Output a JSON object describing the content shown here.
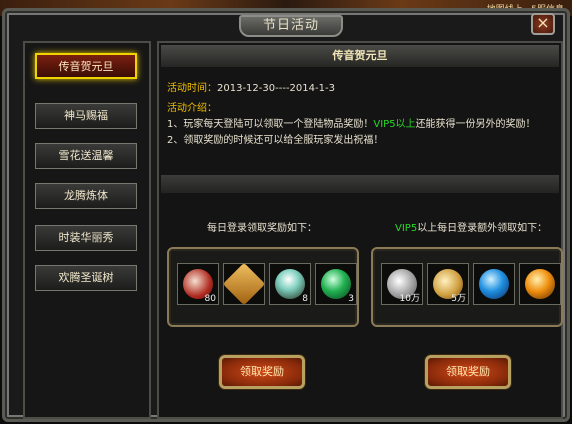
{
  "scene": {
    "top_sliver_text": "地图线上  ·  5服信息"
  },
  "window": {
    "title": "节日活动",
    "close_glyph": "×"
  },
  "sidebar": {
    "items": [
      {
        "label": "传音贺元旦",
        "active": true
      },
      {
        "label": "神马赐福"
      },
      {
        "label": "雪花送温馨"
      },
      {
        "label": "龙腾炼体"
      },
      {
        "label": "时装华丽秀"
      },
      {
        "label": "欢腾圣诞树"
      }
    ]
  },
  "event": {
    "header": "传音贺元旦",
    "time_label": "活动时间：",
    "time_value": "2013-12-30----2014-1-3",
    "intro_label": "活动介绍：",
    "line1_a": "1、玩家每天登陆可以领取一个登陆物品奖励！",
    "line1_vip": "VIP5以上",
    "line1_b": "还能获得一份另外的奖励！",
    "line2": "2、领取奖励的时候还可以给全服玩家发出祝福！"
  },
  "daily": {
    "title": "每日登录领取奖励如下：",
    "items": [
      {
        "icon": "red-stone-icon",
        "count": "80"
      },
      {
        "icon": "scroll-icon",
        "count": ""
      },
      {
        "icon": "crystal-orb-icon",
        "count": "8"
      },
      {
        "icon": "green-orb-icon",
        "count": "3"
      }
    ],
    "button": "领取奖励"
  },
  "vip": {
    "title_vip": "VIP5",
    "title_rest": "以上每日登录额外领取如下：",
    "items": [
      {
        "icon": "silver-coins-icon",
        "count": "10万"
      },
      {
        "icon": "gold-coins-icon",
        "count": "5万"
      },
      {
        "icon": "blue-orb-icon",
        "count": ""
      },
      {
        "icon": "orange-orb-icon",
        "count": ""
      }
    ],
    "button": "领取奖励"
  },
  "colors": {
    "highlight": "#f0c000",
    "vip_green": "#28d828",
    "active_border": "#f0d400"
  }
}
